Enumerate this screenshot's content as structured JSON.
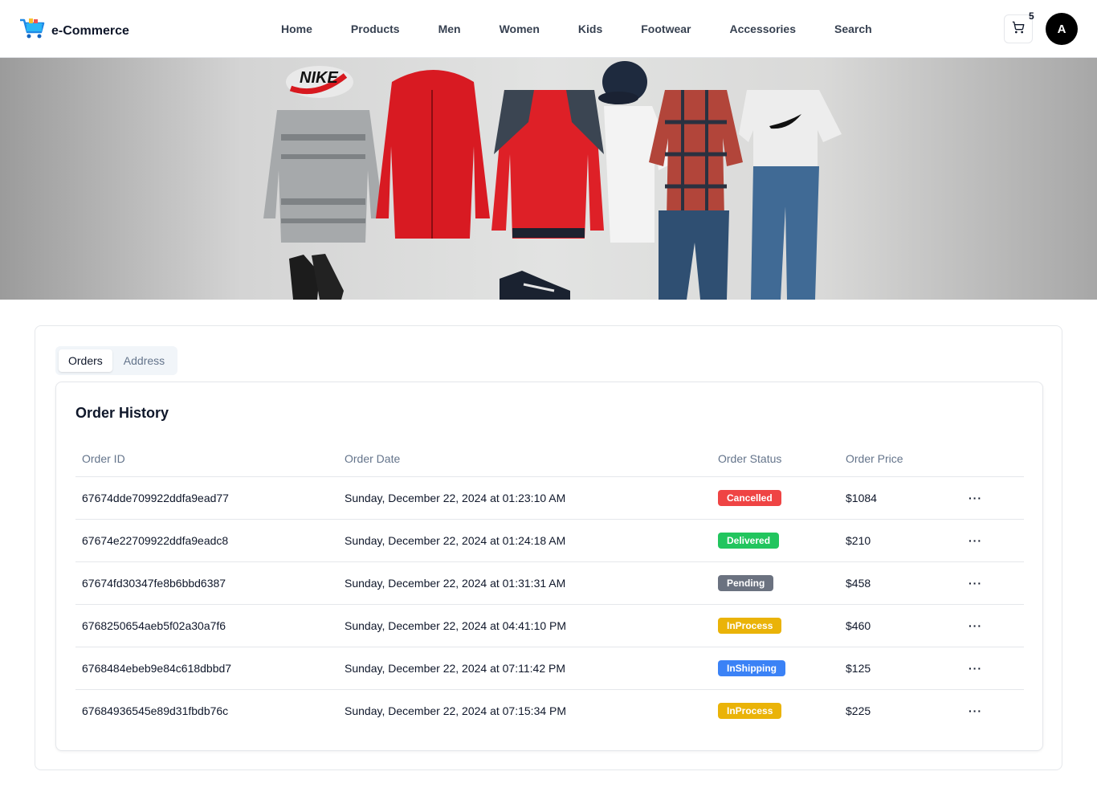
{
  "brand": {
    "name": "e-Commerce",
    "logo_icon": "shopping-cart-logo-icon"
  },
  "nav": [
    "Home",
    "Products",
    "Men",
    "Women",
    "Kids",
    "Footwear",
    "Accessories",
    "Search"
  ],
  "cart": {
    "count": "5",
    "icon": "cart-icon"
  },
  "user": {
    "initial": "A"
  },
  "tabs": [
    "Orders",
    "Address"
  ],
  "orders": {
    "title": "Order History",
    "columns": [
      "Order ID",
      "Order Date",
      "Order Status",
      "Order Price",
      ""
    ],
    "rows": [
      {
        "id": "67674dde709922ddfa9ead77",
        "date": "Sunday, December 22, 2024 at 01:23:10 AM",
        "status": "Cancelled",
        "status_color": "#ef4444",
        "price": "$1084",
        "action": "···"
      },
      {
        "id": "67674e22709922ddfa9eadc8",
        "date": "Sunday, December 22, 2024 at 01:24:18 AM",
        "status": "Delivered",
        "status_color": "#22c55e",
        "price": "$210",
        "action": "···"
      },
      {
        "id": "67674fd30347fe8b6bbd6387",
        "date": "Sunday, December 22, 2024 at 01:31:31 AM",
        "status": "Pending",
        "status_color": "#6b7280",
        "price": "$458",
        "action": "···"
      },
      {
        "id": "6768250654aeb5f02a30a7f6",
        "date": "Sunday, December 22, 2024 at 04:41:10 PM",
        "status": "InProcess",
        "status_color": "#eab308",
        "price": "$460",
        "action": "···"
      },
      {
        "id": "6768484ebeb9e84c618dbbd7",
        "date": "Sunday, December 22, 2024 at 07:11:42 PM",
        "status": "InShipping",
        "status_color": "#3b82f6",
        "price": "$125",
        "action": "···"
      },
      {
        "id": "67684936545e89d31fbdb76c",
        "date": "Sunday, December 22, 2024 at 07:15:34 PM",
        "status": "InProcess",
        "status_color": "#eab308",
        "price": "$225",
        "action": "···"
      }
    ]
  },
  "banner": {
    "text": "NIKE"
  }
}
